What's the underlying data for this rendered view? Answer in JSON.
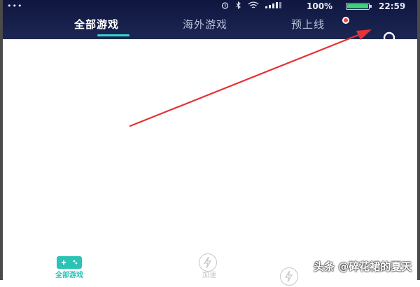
{
  "status_bar": {
    "left_dots": "•••",
    "icons": [
      "alarm-icon",
      "bluetooth-icon",
      "wifi-icon",
      "signal-icon"
    ],
    "battery_percent": "100%",
    "battery_level": 1.0,
    "time": "22:59"
  },
  "tabs": [
    {
      "label": "全部游戏",
      "active": true
    },
    {
      "label": "海外游戏",
      "active": false
    },
    {
      "label": "预上线",
      "active": false,
      "badge_dot": true
    }
  ],
  "search": {
    "icon": "search-icon"
  },
  "bottom_nav": [
    {
      "label": "全部游戏",
      "icon": "gamepad-icon",
      "active": true
    },
    {
      "label": "加速",
      "icon": "lightning-icon",
      "active": false
    },
    {
      "label": "",
      "icon": "lightning-icon",
      "active": false
    }
  ],
  "watermark": "头条 @碎花裙的夏天",
  "colors": {
    "header_bg": "#151e4a",
    "accent": "#2bc3b6",
    "annotation_arrow": "#e63232",
    "badge": "#ff3b4e"
  }
}
